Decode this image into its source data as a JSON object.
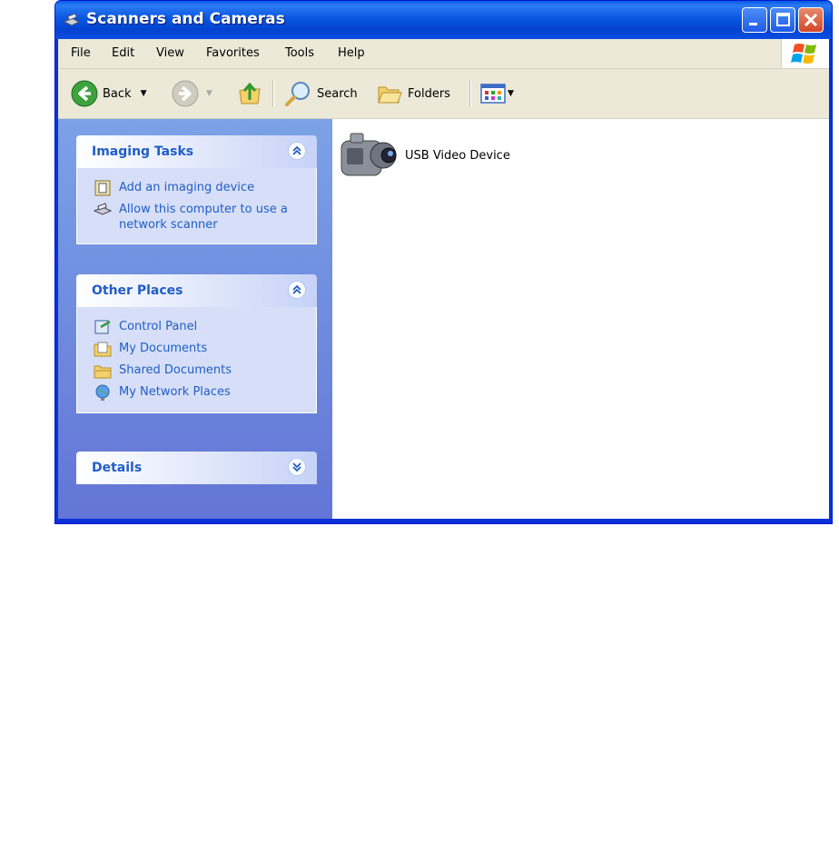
{
  "window": {
    "title": "Scanners and Cameras",
    "title_icon": "scanner-camera-icon"
  },
  "menubar": {
    "items": [
      "File",
      "Edit",
      "View",
      "Favorites",
      "Tools",
      "Help"
    ]
  },
  "toolbar": {
    "back_label": "Back",
    "search_label": "Search",
    "folders_label": "Folders"
  },
  "taskpane": {
    "imaging_tasks": {
      "title": "Imaging Tasks",
      "items": [
        "Add an imaging device",
        "Allow this computer to use a network scanner"
      ]
    },
    "other_places": {
      "title": "Other Places",
      "items": [
        "Control Panel",
        "My Documents",
        "Shared Documents",
        "My Network Places"
      ]
    },
    "details": {
      "title": "Details"
    }
  },
  "main": {
    "devices": [
      {
        "label": "USB Video Device",
        "icon": "camcorder-icon"
      }
    ]
  },
  "colors": {
    "titlebar": "#0a57e0",
    "task_link": "#215dc6",
    "taskpane_bg": "#7ba2e7",
    "menubar_bg": "#ece9d8"
  }
}
